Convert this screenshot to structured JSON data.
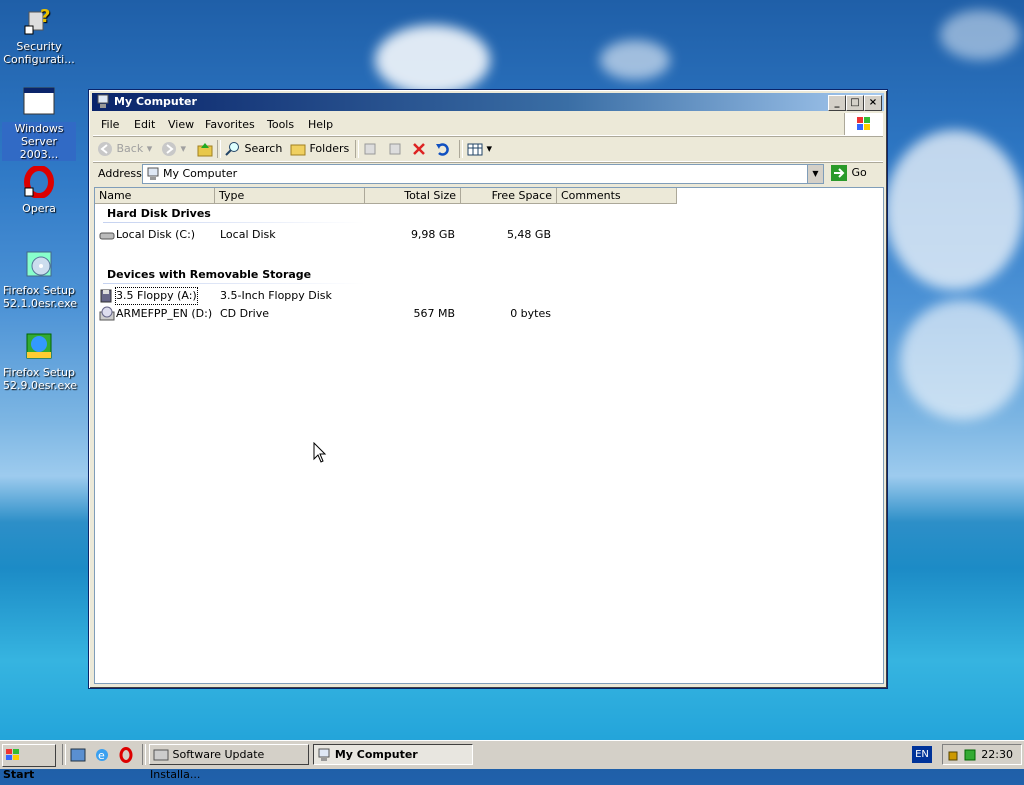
{
  "desktop": {
    "icons": [
      {
        "label": "Security Configurati...",
        "icon": "security-config-icon"
      },
      {
        "label": "Windows Server 2003...",
        "icon": "windows-window-icon"
      },
      {
        "label": "Opera",
        "icon": "opera-icon"
      },
      {
        "label": "Firefox Setup 52.1.0esr.exe",
        "icon": "setup-cd-icon"
      },
      {
        "label": "Firefox Setup 52.9.0esr.exe",
        "icon": "setup-globe-icon"
      }
    ]
  },
  "window": {
    "title": "My Computer",
    "menu": [
      "File",
      "Edit",
      "View",
      "Favorites",
      "Tools",
      "Help"
    ],
    "toolbar": {
      "back": "Back",
      "search": "Search",
      "folders": "Folders"
    },
    "address": {
      "label": "Address",
      "value": "My Computer",
      "go": "Go"
    },
    "columns": [
      "Name",
      "Type",
      "Total Size",
      "Free Space",
      "Comments"
    ],
    "groups": [
      {
        "title": "Hard Disk Drives",
        "items": [
          {
            "name": "Local Disk (C:)",
            "type": "Local Disk",
            "total": "9,98 GB",
            "free": "5,48 GB",
            "comments": ""
          }
        ]
      },
      {
        "title": "Devices with Removable Storage",
        "items": [
          {
            "name": "3.5 Floppy (A:)",
            "type": "3.5-Inch Floppy Disk",
            "total": "",
            "free": "",
            "comments": ""
          },
          {
            "name": "ARMEFPP_EN (D:)",
            "type": "CD Drive",
            "total": "567 MB",
            "free": "0 bytes",
            "comments": ""
          }
        ]
      }
    ]
  },
  "taskbar": {
    "start": "Start",
    "tasks": [
      {
        "label": "Software Update Installa...",
        "active": false
      },
      {
        "label": "My Computer",
        "active": true
      }
    ],
    "lang": "EN",
    "clock": "22:30"
  },
  "colors": {
    "titlebar": "#0a246a",
    "desktop": "#2f79c6",
    "selection": "#316ac5"
  }
}
